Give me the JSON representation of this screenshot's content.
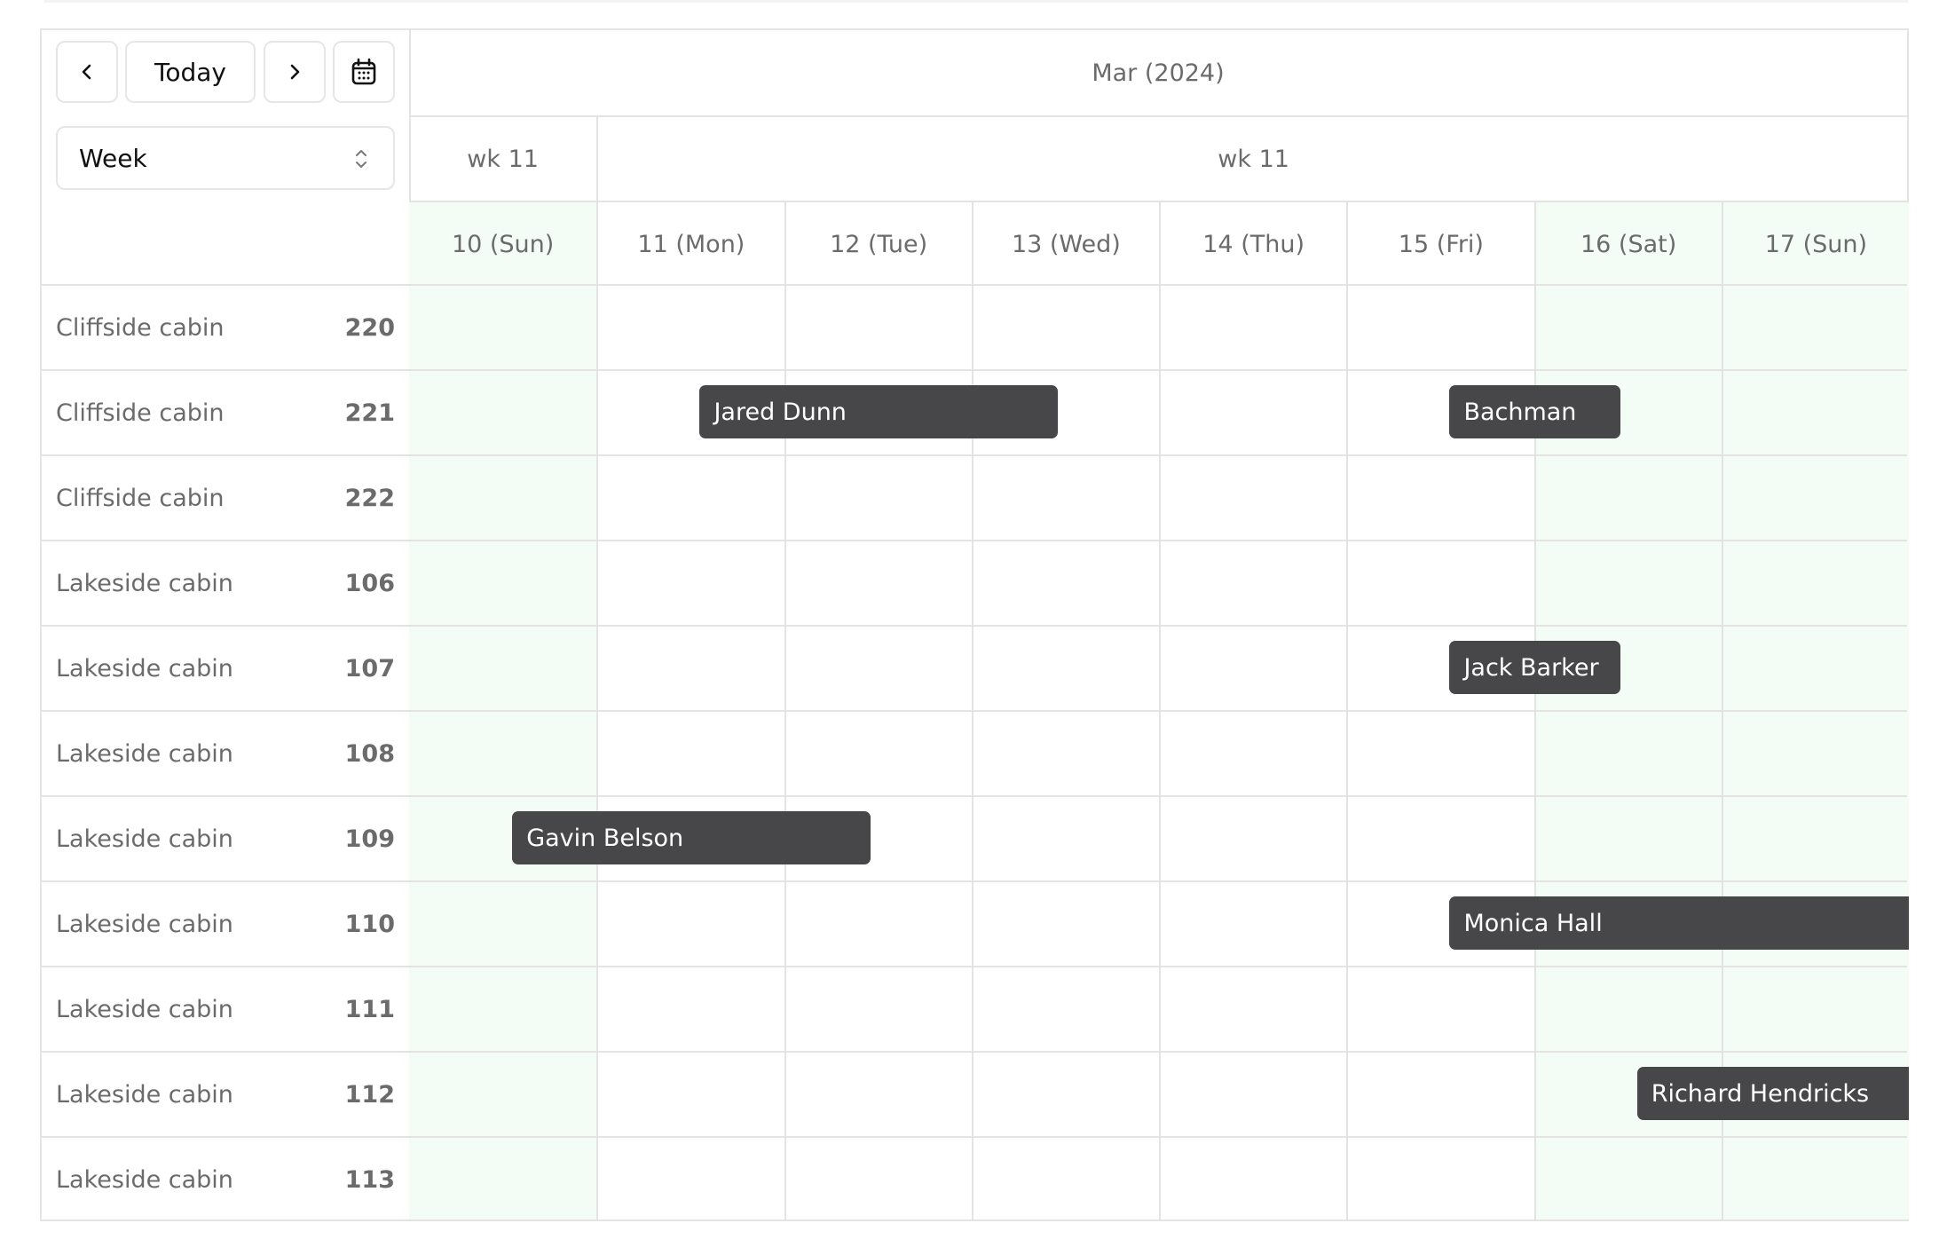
{
  "toolbar": {
    "prev_icon": "chevron-left-icon",
    "today_label": "Today",
    "next_icon": "chevron-right-icon",
    "calendar_icon": "calendar-icon",
    "view_select": {
      "value": "Week",
      "icon": "chevron-up-down-icon"
    }
  },
  "header": {
    "month": "Mar (2024)",
    "weeks": [
      {
        "label": "wk 11",
        "span_days": 1
      },
      {
        "label": "wk 11",
        "span_days": 7
      }
    ],
    "days": [
      {
        "label": "10 (Sun)",
        "weekend": true
      },
      {
        "label": "11 (Mon)",
        "weekend": false
      },
      {
        "label": "12 (Tue)",
        "weekend": false
      },
      {
        "label": "13 (Wed)",
        "weekend": false
      },
      {
        "label": "14 (Thu)",
        "weekend": false
      },
      {
        "label": "15 (Fri)",
        "weekend": false
      },
      {
        "label": "16 (Sat)",
        "weekend": true
      },
      {
        "label": "17 (Sun)",
        "weekend": true
      }
    ]
  },
  "resources": [
    {
      "name": "Cliffside cabin",
      "number": "220"
    },
    {
      "name": "Cliffside cabin",
      "number": "221"
    },
    {
      "name": "Cliffside cabin",
      "number": "222"
    },
    {
      "name": "Lakeside cabin",
      "number": "106"
    },
    {
      "name": "Lakeside cabin",
      "number": "107"
    },
    {
      "name": "Lakeside cabin",
      "number": "108"
    },
    {
      "name": "Lakeside cabin",
      "number": "109"
    },
    {
      "name": "Lakeside cabin",
      "number": "110"
    },
    {
      "name": "Lakeside cabin",
      "number": "111"
    },
    {
      "name": "Lakeside cabin",
      "number": "112"
    },
    {
      "name": "Lakeside cabin",
      "number": "113"
    }
  ],
  "bookings": [
    {
      "guest": "Jared Dunn",
      "resource": "221",
      "start_day": "11 (Mon)",
      "end_day": "13 (Wed)",
      "continues": false
    },
    {
      "guest": "Bachman",
      "resource": "221",
      "start_day": "15 (Fri)",
      "end_day": "16 (Sat)",
      "continues": false
    },
    {
      "guest": "Jack Barker",
      "resource": "107",
      "start_day": "15 (Fri)",
      "end_day": "16 (Sat)",
      "continues": false
    },
    {
      "guest": "Gavin Belson",
      "resource": "109",
      "start_day": "10 (Sun)",
      "end_day": "12 (Tue)",
      "continues": false
    },
    {
      "guest": "Monica Hall",
      "resource": "110",
      "start_day": "15 (Fri)",
      "end_day": null,
      "continues": true
    },
    {
      "guest": "Richard Hendricks",
      "resource": "112",
      "start_day": "16 (Sat)",
      "end_day": null,
      "continues": true
    }
  ],
  "colors": {
    "booking_bg": "#47474a",
    "weekend_bg": "#f3fcf5",
    "grid_line": "#e3e3e3",
    "muted_text": "#6b6b6b"
  }
}
